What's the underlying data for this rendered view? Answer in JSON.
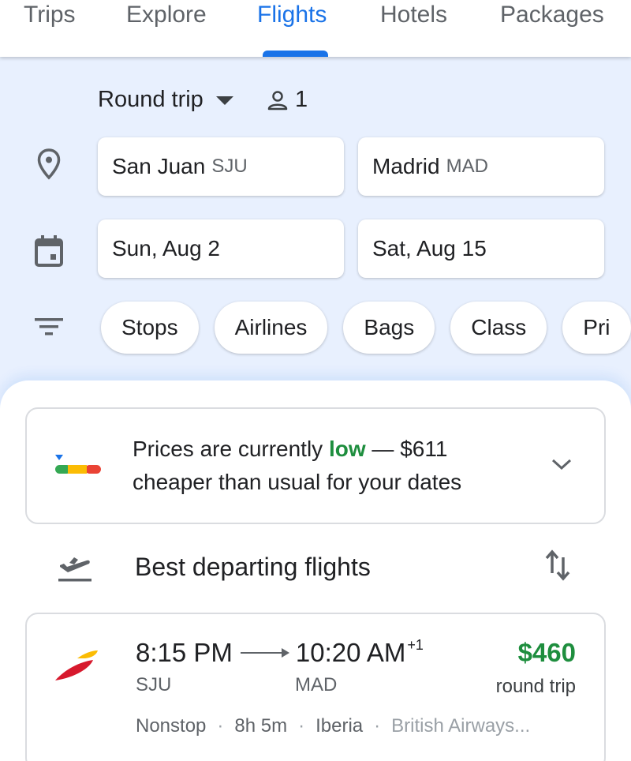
{
  "tabs": [
    {
      "label": "Trips"
    },
    {
      "label": "Explore"
    },
    {
      "label": "Flights",
      "active": true
    },
    {
      "label": "Hotels"
    },
    {
      "label": "Packages"
    }
  ],
  "search": {
    "trip_type": "Round trip",
    "passengers": "1",
    "origin": {
      "city": "San Juan",
      "code": "SJU"
    },
    "destination": {
      "city": "Madrid",
      "code": "MAD"
    },
    "depart_date": "Sun, Aug 2",
    "return_date": "Sat, Aug 15",
    "filters": [
      "Stops",
      "Airlines",
      "Bags",
      "Class",
      "Pri"
    ]
  },
  "insight": {
    "prefix": "Prices are currently",
    "level": "low",
    "suffix": "— $611",
    "line2": "cheaper than usual for your dates"
  },
  "results": {
    "section_title": "Best departing flights"
  },
  "flight": {
    "depart_time": "8:15 PM",
    "arrive_time": "10:20 AM",
    "day_offset": "+1",
    "depart_airport": "SJU",
    "arrive_airport": "MAD",
    "price": "$460",
    "price_note": "round trip",
    "stops": "Nonstop",
    "duration": "8h 5m",
    "airline": "Iberia",
    "operator": "British Airways..."
  },
  "colors": {
    "accent": "#1a73e8",
    "price_green": "#1e8e3e",
    "background": "#e8f0fe"
  }
}
